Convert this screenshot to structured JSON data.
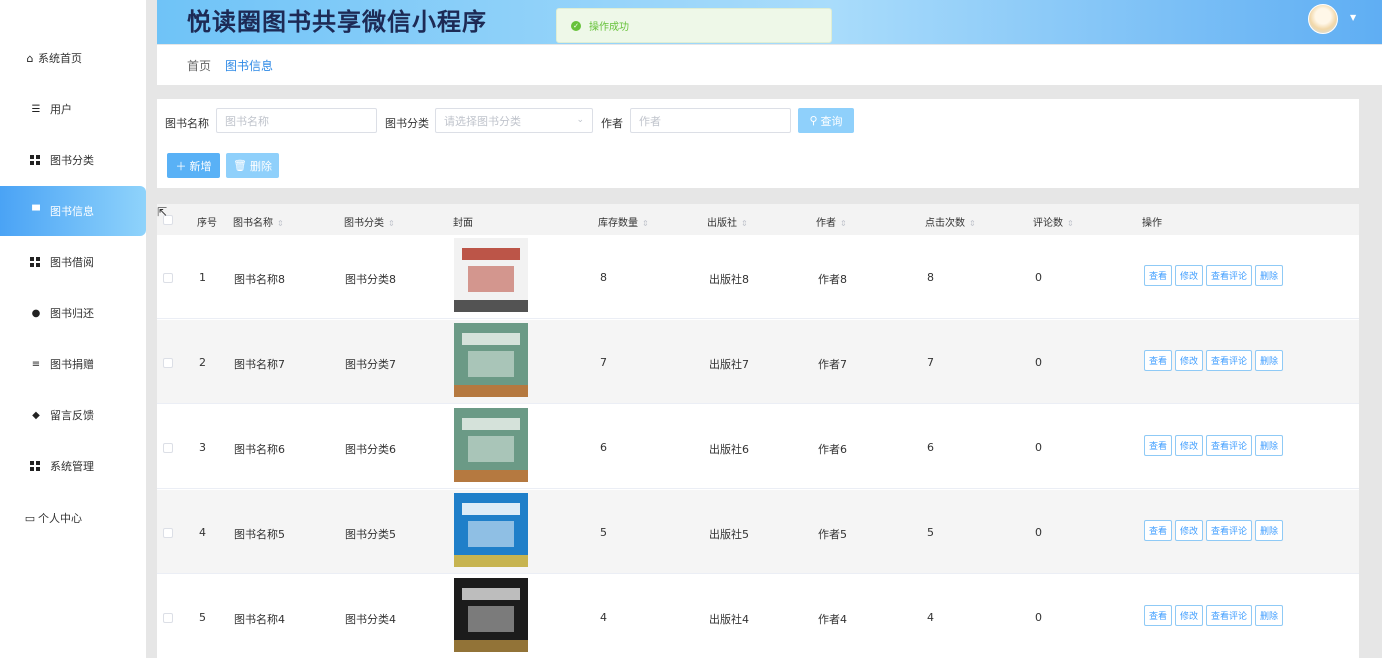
{
  "app": {
    "title": "悦读圈图书共享微信小程序",
    "toast": "操作成功"
  },
  "sidebar": {
    "items": [
      {
        "label": "系统首页",
        "icon": "home-icon"
      },
      {
        "label": "用户",
        "icon": "sliders-icon"
      },
      {
        "label": "图书分类",
        "icon": "grid-icon"
      },
      {
        "label": "图书信息",
        "icon": "monitor-icon",
        "active": true
      },
      {
        "label": "图书借阅",
        "icon": "grid-icon"
      },
      {
        "label": "图书归还",
        "icon": "user-icon"
      },
      {
        "label": "图书捐赠",
        "icon": "list-icon"
      },
      {
        "label": "留言反馈",
        "icon": "location-icon"
      },
      {
        "label": "系统管理",
        "icon": "grid-icon"
      },
      {
        "label": "个人中心",
        "icon": "calendar-icon"
      }
    ]
  },
  "breadcrumb": {
    "home": "首页",
    "current": "图书信息"
  },
  "search": {
    "name_label": "图书名称",
    "name_placeholder": "图书名称",
    "category_label": "图书分类",
    "category_placeholder": "请选择图书分类",
    "author_label": "作者",
    "author_placeholder": "作者",
    "query_button": "查询",
    "add_button": "新增",
    "delete_button": "删除"
  },
  "table": {
    "headers": {
      "index": "序号",
      "name": "图书名称",
      "category": "图书分类",
      "cover": "封面",
      "stock": "库存数量",
      "publisher": "出版社",
      "author": "作者",
      "clicks": "点击次数",
      "comments": "评论数",
      "actions": "操作"
    },
    "actions": {
      "view": "查看",
      "edit": "修改",
      "view_comments": "查看评论",
      "delete": "删除"
    },
    "rows": [
      {
        "index": "1",
        "name": "图书名称8",
        "category": "图书分类8",
        "stock": "8",
        "publisher": "出版社8",
        "author": "作者8",
        "clicks": "8",
        "comments": "0",
        "cover_colors": [
          "#f2f2f2",
          "#b33a2a",
          "#2b2b2b"
        ]
      },
      {
        "index": "2",
        "name": "图书名称7",
        "category": "图书分类7",
        "stock": "7",
        "publisher": "出版社7",
        "author": "作者7",
        "clicks": "7",
        "comments": "0",
        "cover_colors": [
          "#6b9a86",
          "#e8efe9",
          "#c8702e"
        ]
      },
      {
        "index": "3",
        "name": "图书名称6",
        "category": "图书分类6",
        "stock": "6",
        "publisher": "出版社6",
        "author": "作者6",
        "clicks": "6",
        "comments": "0",
        "cover_colors": [
          "#6b9a86",
          "#e8efe9",
          "#c8702e"
        ]
      },
      {
        "index": "4",
        "name": "图书名称5",
        "category": "图书分类5",
        "stock": "5",
        "publisher": "出版社5",
        "author": "作者5",
        "clicks": "5",
        "comments": "0",
        "cover_colors": [
          "#1f7fc9",
          "#ffffff",
          "#f1c232"
        ]
      },
      {
        "index": "5",
        "name": "图书名称4",
        "category": "图书分类4",
        "stock": "4",
        "publisher": "出版社4",
        "author": "作者4",
        "clicks": "4",
        "comments": "0",
        "cover_colors": [
          "#1c1c1c",
          "#d9d9d9",
          "#b08a3e"
        ]
      }
    ]
  }
}
